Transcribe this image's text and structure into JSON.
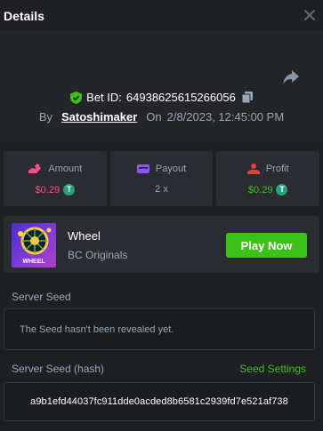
{
  "header": {
    "title": "Details",
    "close_icon": "close-icon"
  },
  "bet": {
    "bet_id_label": "Bet ID:",
    "bet_id": "64938625615266056",
    "by_label": "By",
    "user": "Satoshimaker",
    "on_label": "On",
    "datetime": "2/8/2023, 12:45:00 PM",
    "verified_color": "#3bc117"
  },
  "stats": {
    "amount": {
      "label": "Amount",
      "value": "$0.29",
      "icon": "bet-hand-icon",
      "color": "#ff4d8a"
    },
    "payout": {
      "label": "Payout",
      "value": "2 x",
      "icon": "wallet-icon",
      "color": "#8a56ff"
    },
    "profit": {
      "label": "Profit",
      "value": "$0.29",
      "icon": "profit-hand-icon",
      "color": "#ed3b3b"
    }
  },
  "currency": {
    "icon": "usdt-icon",
    "symbol": "T",
    "color": "#26a17b"
  },
  "game": {
    "name": "Wheel",
    "provider": "BC Originals",
    "thumb_label": "WHEEL",
    "play_label": "Play Now"
  },
  "server_seed": {
    "label": "Server Seed",
    "message": "The Seed hasn't been revealed yet."
  },
  "server_seed_hash": {
    "label": "Server Seed (hash)",
    "settings_label": "Seed Settings",
    "value": "a9b1efd44037fc911dde0acded8b6581c2939fd7e521af738"
  }
}
